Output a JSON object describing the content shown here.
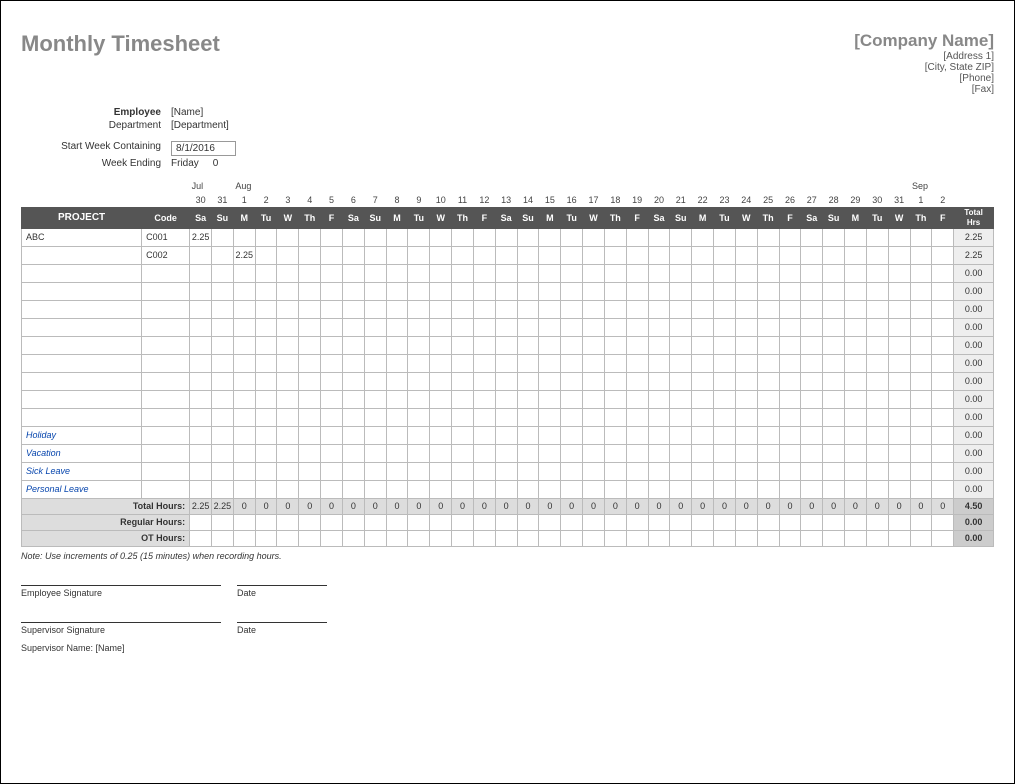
{
  "title": "Monthly Timesheet",
  "company": {
    "name": "[Company Name]",
    "address1": "[Address 1]",
    "city": "[City, State ZIP]",
    "phone": "[Phone]",
    "fax": "[Fax]"
  },
  "info": {
    "employee_label": "Employee",
    "employee_value": "[Name]",
    "department_label": "Department",
    "department_value": "[Department]",
    "start_week_label": "Start Week Containing",
    "start_week_value": "8/1/2016",
    "week_ending_label": "Week Ending",
    "week_ending_value": "Friday",
    "week_ending_extra": "0"
  },
  "months": {
    "jul": "Jul",
    "aug": "Aug",
    "sep": "Sep"
  },
  "dates": [
    "30",
    "31",
    "1",
    "2",
    "3",
    "4",
    "5",
    "6",
    "7",
    "8",
    "9",
    "10",
    "11",
    "12",
    "13",
    "14",
    "15",
    "16",
    "17",
    "18",
    "19",
    "20",
    "21",
    "22",
    "23",
    "24",
    "25",
    "26",
    "27",
    "28",
    "29",
    "30",
    "31",
    "1",
    "2"
  ],
  "days": [
    "Sa",
    "Su",
    "M",
    "Tu",
    "W",
    "Th",
    "F",
    "Sa",
    "Su",
    "M",
    "Tu",
    "W",
    "Th",
    "F",
    "Sa",
    "Su",
    "M",
    "Tu",
    "W",
    "Th",
    "F",
    "Sa",
    "Su",
    "M",
    "Tu",
    "W",
    "Th",
    "F",
    "Sa",
    "Su",
    "M",
    "Tu",
    "W",
    "Th",
    "F"
  ],
  "headers": {
    "project": "PROJECT",
    "code": "Code",
    "total": "Total Hrs"
  },
  "rows": [
    {
      "project": "ABC",
      "code": "C001",
      "cells": [
        "2.25",
        "",
        "",
        "",
        "",
        "",
        "",
        "",
        "",
        "",
        "",
        "",
        "",
        "",
        "",
        "",
        "",
        "",
        "",
        "",
        "",
        "",
        "",
        "",
        "",
        "",
        "",
        "",
        "",
        "",
        "",
        "",
        "",
        "",
        ""
      ],
      "total": "2.25",
      "leave": false
    },
    {
      "project": "",
      "code": "C002",
      "cells": [
        "",
        "",
        "2.25",
        "",
        "",
        "",
        "",
        "",
        "",
        "",
        "",
        "",
        "",
        "",
        "",
        "",
        "",
        "",
        "",
        "",
        "",
        "",
        "",
        "",
        "",
        "",
        "",
        "",
        "",
        "",
        "",
        "",
        "",
        "",
        ""
      ],
      "total": "2.25",
      "leave": false
    },
    {
      "project": "",
      "code": "",
      "cells": [
        "",
        "",
        "",
        "",
        "",
        "",
        "",
        "",
        "",
        "",
        "",
        "",
        "",
        "",
        "",
        "",
        "",
        "",
        "",
        "",
        "",
        "",
        "",
        "",
        "",
        "",
        "",
        "",
        "",
        "",
        "",
        "",
        "",
        "",
        ""
      ],
      "total": "0.00",
      "leave": false
    },
    {
      "project": "",
      "code": "",
      "cells": [
        "",
        "",
        "",
        "",
        "",
        "",
        "",
        "",
        "",
        "",
        "",
        "",
        "",
        "",
        "",
        "",
        "",
        "",
        "",
        "",
        "",
        "",
        "",
        "",
        "",
        "",
        "",
        "",
        "",
        "",
        "",
        "",
        "",
        "",
        ""
      ],
      "total": "0.00",
      "leave": false
    },
    {
      "project": "",
      "code": "",
      "cells": [
        "",
        "",
        "",
        "",
        "",
        "",
        "",
        "",
        "",
        "",
        "",
        "",
        "",
        "",
        "",
        "",
        "",
        "",
        "",
        "",
        "",
        "",
        "",
        "",
        "",
        "",
        "",
        "",
        "",
        "",
        "",
        "",
        "",
        "",
        ""
      ],
      "total": "0.00",
      "leave": false
    },
    {
      "project": "",
      "code": "",
      "cells": [
        "",
        "",
        "",
        "",
        "",
        "",
        "",
        "",
        "",
        "",
        "",
        "",
        "",
        "",
        "",
        "",
        "",
        "",
        "",
        "",
        "",
        "",
        "",
        "",
        "",
        "",
        "",
        "",
        "",
        "",
        "",
        "",
        "",
        "",
        ""
      ],
      "total": "0.00",
      "leave": false
    },
    {
      "project": "",
      "code": "",
      "cells": [
        "",
        "",
        "",
        "",
        "",
        "",
        "",
        "",
        "",
        "",
        "",
        "",
        "",
        "",
        "",
        "",
        "",
        "",
        "",
        "",
        "",
        "",
        "",
        "",
        "",
        "",
        "",
        "",
        "",
        "",
        "",
        "",
        "",
        "",
        ""
      ],
      "total": "0.00",
      "leave": false
    },
    {
      "project": "",
      "code": "",
      "cells": [
        "",
        "",
        "",
        "",
        "",
        "",
        "",
        "",
        "",
        "",
        "",
        "",
        "",
        "",
        "",
        "",
        "",
        "",
        "",
        "",
        "",
        "",
        "",
        "",
        "",
        "",
        "",
        "",
        "",
        "",
        "",
        "",
        "",
        "",
        ""
      ],
      "total": "0.00",
      "leave": false
    },
    {
      "project": "",
      "code": "",
      "cells": [
        "",
        "",
        "",
        "",
        "",
        "",
        "",
        "",
        "",
        "",
        "",
        "",
        "",
        "",
        "",
        "",
        "",
        "",
        "",
        "",
        "",
        "",
        "",
        "",
        "",
        "",
        "",
        "",
        "",
        "",
        "",
        "",
        "",
        "",
        ""
      ],
      "total": "0.00",
      "leave": false
    },
    {
      "project": "",
      "code": "",
      "cells": [
        "",
        "",
        "",
        "",
        "",
        "",
        "",
        "",
        "",
        "",
        "",
        "",
        "",
        "",
        "",
        "",
        "",
        "",
        "",
        "",
        "",
        "",
        "",
        "",
        "",
        "",
        "",
        "",
        "",
        "",
        "",
        "",
        "",
        "",
        ""
      ],
      "total": "0.00",
      "leave": false
    },
    {
      "project": "",
      "code": "",
      "cells": [
        "",
        "",
        "",
        "",
        "",
        "",
        "",
        "",
        "",
        "",
        "",
        "",
        "",
        "",
        "",
        "",
        "",
        "",
        "",
        "",
        "",
        "",
        "",
        "",
        "",
        "",
        "",
        "",
        "",
        "",
        "",
        "",
        "",
        "",
        ""
      ],
      "total": "0.00",
      "leave": false
    },
    {
      "project": "Holiday",
      "code": "",
      "cells": [
        "",
        "",
        "",
        "",
        "",
        "",
        "",
        "",
        "",
        "",
        "",
        "",
        "",
        "",
        "",
        "",
        "",
        "",
        "",
        "",
        "",
        "",
        "",
        "",
        "",
        "",
        "",
        "",
        "",
        "",
        "",
        "",
        "",
        "",
        ""
      ],
      "total": "0.00",
      "leave": true
    },
    {
      "project": "Vacation",
      "code": "",
      "cells": [
        "",
        "",
        "",
        "",
        "",
        "",
        "",
        "",
        "",
        "",
        "",
        "",
        "",
        "",
        "",
        "",
        "",
        "",
        "",
        "",
        "",
        "",
        "",
        "",
        "",
        "",
        "",
        "",
        "",
        "",
        "",
        "",
        "",
        "",
        ""
      ],
      "total": "0.00",
      "leave": true
    },
    {
      "project": "Sick Leave",
      "code": "",
      "cells": [
        "",
        "",
        "",
        "",
        "",
        "",
        "",
        "",
        "",
        "",
        "",
        "",
        "",
        "",
        "",
        "",
        "",
        "",
        "",
        "",
        "",
        "",
        "",
        "",
        "",
        "",
        "",
        "",
        "",
        "",
        "",
        "",
        "",
        "",
        ""
      ],
      "total": "0.00",
      "leave": true
    },
    {
      "project": "Personal Leave",
      "code": "",
      "cells": [
        "",
        "",
        "",
        "",
        "",
        "",
        "",
        "",
        "",
        "",
        "",
        "",
        "",
        "",
        "",
        "",
        "",
        "",
        "",
        "",
        "",
        "",
        "",
        "",
        "",
        "",
        "",
        "",
        "",
        "",
        "",
        "",
        "",
        "",
        ""
      ],
      "total": "0.00",
      "leave": true
    }
  ],
  "summary": {
    "total_label": "Total Hours:",
    "total_cells": [
      "2.25",
      "2.25",
      "0",
      "0",
      "0",
      "0",
      "0",
      "0",
      "0",
      "0",
      "0",
      "0",
      "0",
      "0",
      "0",
      "0",
      "0",
      "0",
      "0",
      "0",
      "0",
      "0",
      "0",
      "0",
      "0",
      "0",
      "0",
      "0",
      "0",
      "0",
      "0",
      "0",
      "0",
      "0",
      "0"
    ],
    "total_total": "4.50",
    "regular_label": "Regular Hours:",
    "regular_cells": [
      "",
      "",
      "",
      "",
      "",
      "",
      "",
      "",
      "",
      "",
      "",
      "",
      "",
      "",
      "",
      "",
      "",
      "",
      "",
      "",
      "",
      "",
      "",
      "",
      "",
      "",
      "",
      "",
      "",
      "",
      "",
      "",
      "",
      "",
      ""
    ],
    "regular_total": "0.00",
    "ot_label": "OT Hours:",
    "ot_cells": [
      "",
      "",
      "",
      "",
      "",
      "",
      "",
      "",
      "",
      "",
      "",
      "",
      "",
      "",
      "",
      "",
      "",
      "",
      "",
      "",
      "",
      "",
      "",
      "",
      "",
      "",
      "",
      "",
      "",
      "",
      "",
      "",
      "",
      "",
      ""
    ],
    "ot_total": "0.00"
  },
  "note": "Note: Use increments of 0.25 (15 minutes) when recording hours.",
  "signatures": {
    "employee": "Employee Signature",
    "supervisor": "Supervisor Signature",
    "date": "Date",
    "supervisor_name_label": "Supervisor Name:",
    "supervisor_name_value": "[Name]"
  }
}
